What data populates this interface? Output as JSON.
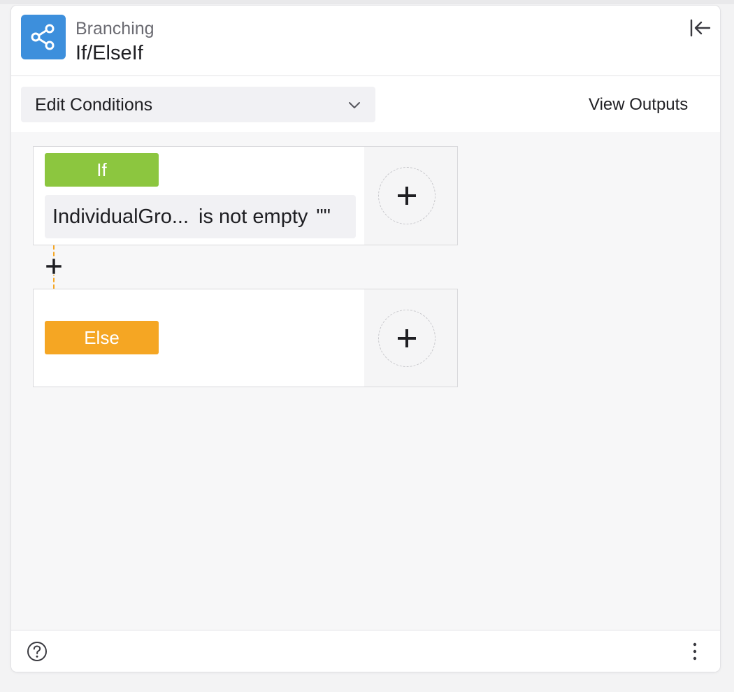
{
  "header": {
    "category": "Branching",
    "title": "If/ElseIf",
    "app_icon": "share-nodes-icon",
    "collapse_icon": "collapse-left-icon"
  },
  "toolbar": {
    "dropdown_value": "Edit Conditions",
    "view_outputs_label": "View Outputs"
  },
  "conditions": {
    "if_label": "If",
    "if_condition": {
      "field": "IndividualGro...",
      "operator": "is not empty",
      "value": "\"\""
    },
    "else_label": "Else"
  },
  "colors": {
    "if_badge": "#8cc63f",
    "else_badge": "#f5a623",
    "app_icon_bg": "#3d8fdc",
    "connector": "#f5a623"
  },
  "footer": {
    "help_icon": "question-circle-icon",
    "more_icon": "vertical-ellipsis-icon"
  }
}
